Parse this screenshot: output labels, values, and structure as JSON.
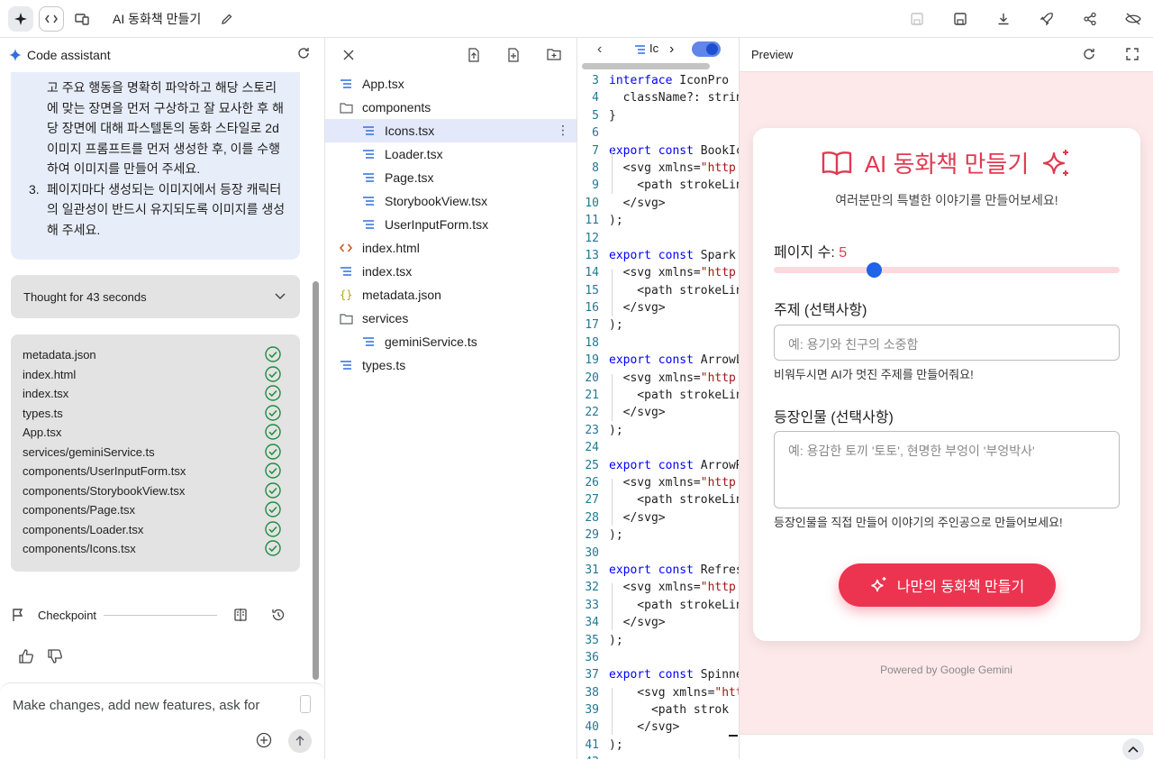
{
  "topbar": {
    "app_title": "AI 동화책 만들기"
  },
  "assistant": {
    "title": "Code assistant",
    "message": {
      "lines": [
        "고 주요 행동을 명확히 파악하고 해당 스토리",
        "에 맞는 장면을 먼저 구상하고 잘 묘사한 후 해",
        "당 장면에 대해 파스텔톤의 동화 스타일로 2d",
        "이미지 프롬프트를 먼저 생성한 후, 이를 수행",
        "하여 이미지를 만들어 주세요."
      ],
      "item3_num": "3.",
      "item3_lines": [
        "페이지마다 생성되는 이미지에서 등장 캐릭터",
        "의 일관성이 반드시 유지되도록 이미지를 생성",
        "해 주세요."
      ]
    },
    "thought": "Thought for 43 seconds",
    "files": [
      "metadata.json",
      "index.html",
      "index.tsx",
      "types.ts",
      "App.tsx",
      "services/geminiService.ts",
      "components/UserInputForm.tsx",
      "components/StorybookView.tsx",
      "components/Page.tsx",
      "components/Loader.tsx",
      "components/Icons.tsx"
    ],
    "checkpoint": "Checkpoint",
    "input_placeholder": "Make changes, add new features, ask for"
  },
  "tree": {
    "items": [
      {
        "label": "App.tsx",
        "icon": "lines-icon",
        "indent": 0
      },
      {
        "label": "components",
        "icon": "folder-icon",
        "indent": 0
      },
      {
        "label": "Icons.tsx",
        "icon": "lines-icon",
        "indent": 1,
        "selected": true
      },
      {
        "label": "Loader.tsx",
        "icon": "lines-icon",
        "indent": 1
      },
      {
        "label": "Page.tsx",
        "icon": "lines-icon",
        "indent": 1
      },
      {
        "label": "StorybookView.tsx",
        "icon": "lines-icon",
        "indent": 1
      },
      {
        "label": "UserInputForm.tsx",
        "icon": "lines-icon",
        "indent": 1
      },
      {
        "label": "index.html",
        "icon": "html-icon",
        "indent": 0
      },
      {
        "label": "index.tsx",
        "icon": "lines-icon",
        "indent": 0
      },
      {
        "label": "metadata.json",
        "icon": "json-icon",
        "indent": 0
      },
      {
        "label": "services",
        "icon": "folder-icon",
        "indent": 0
      },
      {
        "label": "geminiService.ts",
        "icon": "lines-icon",
        "indent": 1
      },
      {
        "label": "types.ts",
        "icon": "lines-icon",
        "indent": 0
      }
    ]
  },
  "code": {
    "tab_label": "Ic",
    "lines": [
      {
        "n": "3",
        "k": "interface",
        "r": " IconPro"
      },
      {
        "n": "4",
        "k": "",
        "r": "  className?: strin"
      },
      {
        "n": "5",
        "k": "",
        "r": "}"
      },
      {
        "n": "6",
        "k": "",
        "r": ""
      },
      {
        "n": "7",
        "k": "export const",
        "r": " BookIc"
      },
      {
        "n": "8",
        "k": "",
        "r": "  <svg xmlns=",
        "s": "\"http:"
      },
      {
        "n": "9",
        "k": "",
        "r": "    <path strokeLin"
      },
      {
        "n": "10",
        "k": "",
        "r": "  </svg>"
      },
      {
        "n": "11",
        "k": "",
        "r": ");"
      },
      {
        "n": "12",
        "k": "",
        "r": ""
      },
      {
        "n": "13",
        "k": "export const",
        "r": " Spark"
      },
      {
        "n": "14",
        "k": "",
        "r": "  <svg xmlns=",
        "s": "\"http:"
      },
      {
        "n": "15",
        "k": "",
        "r": "    <path strokeLin"
      },
      {
        "n": "16",
        "k": "",
        "r": "  </svg>"
      },
      {
        "n": "17",
        "k": "",
        "r": ");"
      },
      {
        "n": "18",
        "k": "",
        "r": ""
      },
      {
        "n": "19",
        "k": "export const",
        "r": " ArrowL"
      },
      {
        "n": "20",
        "k": "",
        "r": "  <svg xmlns=",
        "s": "\"http:"
      },
      {
        "n": "21",
        "k": "",
        "r": "    <path strokeLin"
      },
      {
        "n": "22",
        "k": "",
        "r": "  </svg>"
      },
      {
        "n": "23",
        "k": "",
        "r": ");"
      },
      {
        "n": "24",
        "k": "",
        "r": ""
      },
      {
        "n": "25",
        "k": "export const",
        "r": " ArrowR"
      },
      {
        "n": "26",
        "k": "",
        "r": "  <svg xmlns=",
        "s": "\"http:"
      },
      {
        "n": "27",
        "k": "",
        "r": "    <path strokeLin"
      },
      {
        "n": "28",
        "k": "",
        "r": "  </svg>"
      },
      {
        "n": "29",
        "k": "",
        "r": ");"
      },
      {
        "n": "30",
        "k": "",
        "r": ""
      },
      {
        "n": "31",
        "k": "export const",
        "r": " Refres"
      },
      {
        "n": "32",
        "k": "",
        "r": "  <svg xmlns=",
        "s": "\"http:"
      },
      {
        "n": "33",
        "k": "",
        "r": "    <path strokeLin"
      },
      {
        "n": "34",
        "k": "",
        "r": "  </svg>"
      },
      {
        "n": "35",
        "k": "",
        "r": ");"
      },
      {
        "n": "36",
        "k": "",
        "r": ""
      },
      {
        "n": "37",
        "k": "export const",
        "r": " Spinne"
      },
      {
        "n": "38",
        "k": "",
        "r": "    <svg xmlns=",
        "s": "\"htt"
      },
      {
        "n": "39",
        "k": "",
        "r": "      <path strok"
      },
      {
        "n": "40",
        "k": "",
        "r": "    </svg>"
      },
      {
        "n": "41",
        "k": "",
        "r": ");"
      },
      {
        "n": "42",
        "k": "",
        "r": ""
      }
    ]
  },
  "preview": {
    "title": "Preview",
    "app": {
      "heading": "AI 동화책 만들기",
      "subtitle": "여러분만의 특별한 이야기를 만들어보세요!",
      "pages_label": "페이지 수:",
      "pages_value": "5",
      "pages_slider_fraction": 0.29,
      "topic_label": "주제 (선택사항)",
      "topic_placeholder": "예: 용기와 친구의 소중함",
      "topic_hint": "비워두시면 AI가 멋진 주제를 만들어줘요!",
      "chars_label": "등장인물 (선택사항)",
      "chars_placeholder": "예: 용감한 토끼 '토토', 현명한 부엉이 '부엉박사'",
      "chars_hint": "등장인물을 직접 만들어 이야기의 주인공으로 만들어보세요!",
      "button": "나만의 동화책 만들기",
      "accent": "#e03a50"
    },
    "powered": "Powered by Google Gemini"
  }
}
